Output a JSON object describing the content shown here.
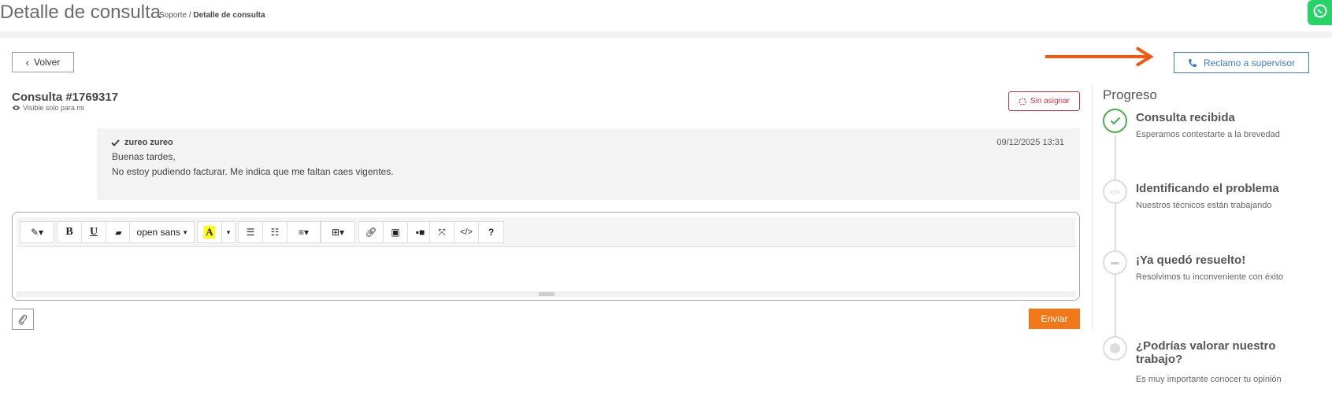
{
  "header": {
    "title": "Detalle de consulta",
    "breadcrumb_root": "Soporte",
    "breadcrumb_sep": " / ",
    "breadcrumb_current": "Detalle de consulta"
  },
  "actions": {
    "back_label": "Volver",
    "supervisor_label": "Reclamo a supervisor"
  },
  "ticket": {
    "title": "Consulta #1769317",
    "visibility": "Visible solo para mi",
    "status_badge": "Sin asignar"
  },
  "message": {
    "author": "zureo zureo",
    "date": "09/12/2025 13:31",
    "line1": "Buenas tardes,",
    "line2": "No estoy pudiendo facturar. Me indica que me faltan caes vigentes."
  },
  "editor": {
    "font_select": "open sans",
    "send_label": "Enviar"
  },
  "progress": {
    "title": "Progreso",
    "steps": [
      {
        "title": "Consulta recibida",
        "desc": "Esperamos contestarte a la brevedad",
        "state": "done"
      },
      {
        "title": "Identificando el problema",
        "desc": "Nuestros técnicos están trabajando",
        "state": "pending"
      },
      {
        "title": "¡Ya quedó resuelto!",
        "desc": "Resolvimos tu inconveniente con éxito",
        "state": "pending"
      },
      {
        "title": "¿Podrías valorar nuestro trabajo?",
        "desc": "Es muy importante conocer tu opinión",
        "state": "pending"
      }
    ]
  },
  "colors": {
    "accent_blue": "#3b7dd8",
    "send_orange": "#f07818",
    "badge_red": "#d9333f",
    "done_green": "#4caf50"
  }
}
